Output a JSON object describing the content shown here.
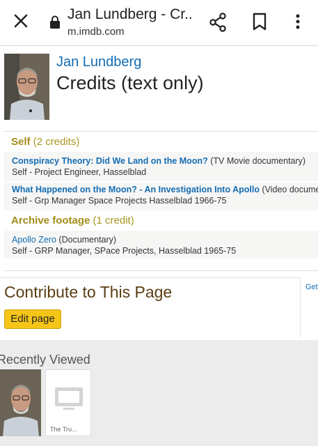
{
  "browser": {
    "tab_title": "Jan Lundberg - Cr...",
    "url": "m.imdb.com",
    "icons": [
      "close-icon",
      "lock-icon",
      "share-icon",
      "bookmark-icon",
      "more-vert-icon"
    ]
  },
  "header": {
    "name": "Jan Lundberg",
    "title": "Credits (text only)"
  },
  "sections": {
    "self": {
      "label": "Self",
      "count": "(2 credits)",
      "credits": [
        {
          "title": "Conspiracy Theory: Did We Land on the Moon?",
          "type": "(TV Movie documentary)",
          "role": "Self - Project Engineer, Hasselblad"
        },
        {
          "title": "What Happened on the Moon? - An Investigation Into Apollo",
          "type": "(Video documentary)",
          "role": "Self - Grp Manager Space Projects Hasselblad 1966-75"
        }
      ]
    },
    "archive": {
      "label": "Archive footage",
      "count": "(1 credit)",
      "credits": [
        {
          "title": "Apollo Zero",
          "type": "(Documentary)",
          "role": "Self - GRP Manager, SPace Projects, Hasselblad 1965-75"
        }
      ]
    }
  },
  "contribute": {
    "title": "Contribute to This Page",
    "edit_label": "Edit page",
    "side_link": "Getting Started"
  },
  "recently_viewed": {
    "title": "Recently Viewed",
    "items": [
      {
        "kind": "person-photo"
      },
      {
        "kind": "title",
        "label": "The Tru..."
      }
    ]
  },
  "colors": {
    "link": "#136cb2",
    "section_heading": "#a28d1a",
    "button": "#f5c518",
    "contribute_title": "#5a3e12"
  }
}
